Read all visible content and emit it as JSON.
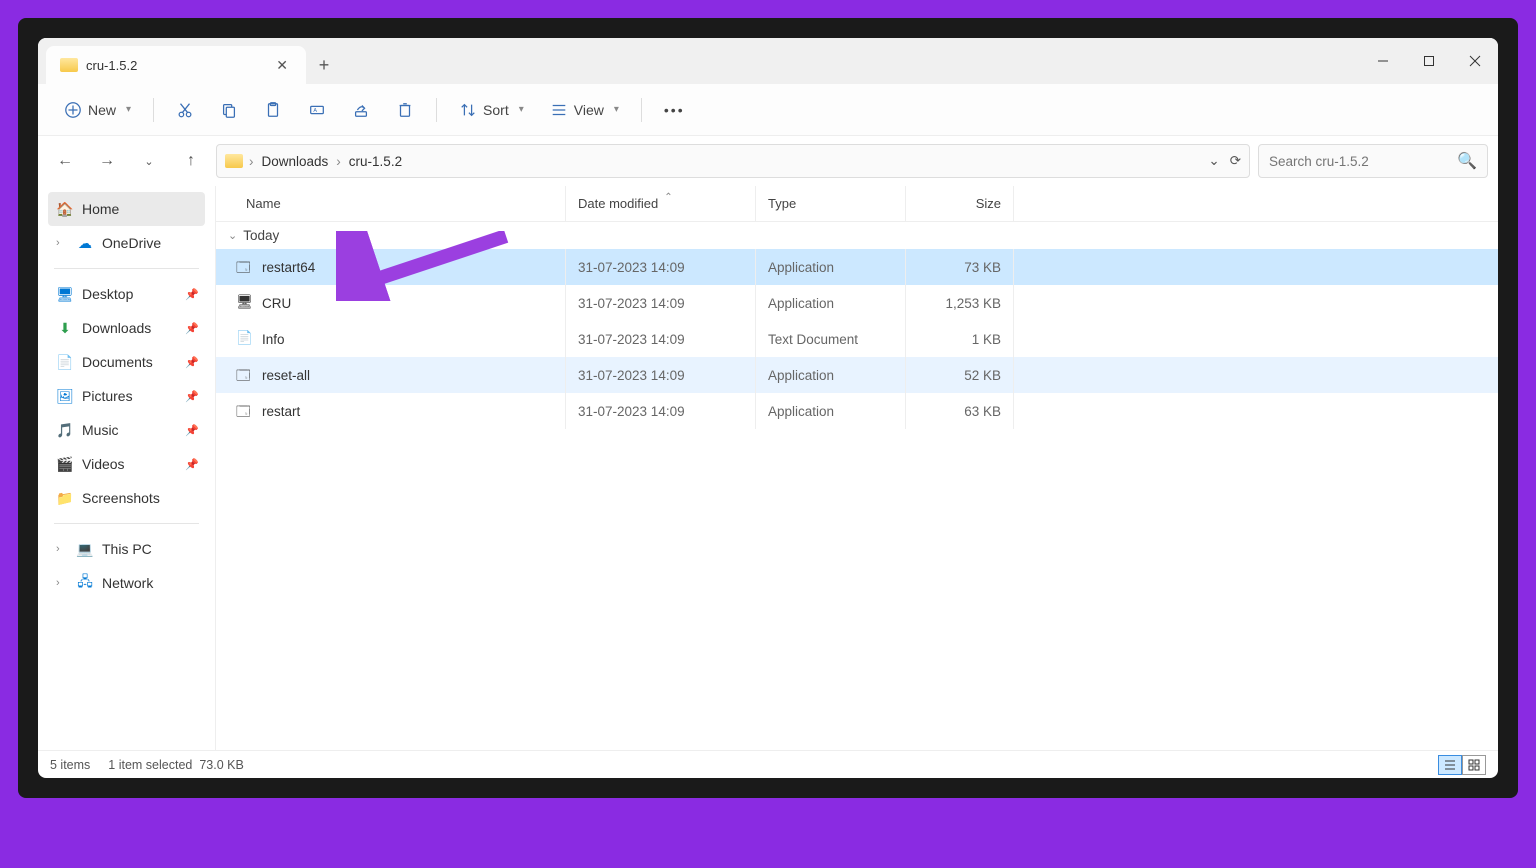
{
  "tab": {
    "title": "cru-1.5.2"
  },
  "toolbar": {
    "new": "New",
    "sort": "Sort",
    "view": "View"
  },
  "breadcrumb": {
    "items": [
      "Downloads",
      "cru-1.5.2"
    ]
  },
  "search": {
    "placeholder": "Search cru-1.5.2"
  },
  "sidebar": {
    "home": "Home",
    "onedrive": "OneDrive",
    "desktop": "Desktop",
    "downloads": "Downloads",
    "documents": "Documents",
    "pictures": "Pictures",
    "music": "Music",
    "videos": "Videos",
    "screenshots": "Screenshots",
    "thispc": "This PC",
    "network": "Network"
  },
  "columns": {
    "name": "Name",
    "date": "Date modified",
    "type": "Type",
    "size": "Size"
  },
  "group": "Today",
  "files": [
    {
      "name": "restart64",
      "date": "31-07-2023 14:09",
      "type": "Application",
      "size": "73 KB",
      "icon": "app",
      "sel": true
    },
    {
      "name": "CRU",
      "date": "31-07-2023 14:09",
      "type": "Application",
      "size": "1,253 KB",
      "icon": "cru",
      "sel": false
    },
    {
      "name": "Info",
      "date": "31-07-2023 14:09",
      "type": "Text Document",
      "size": "1 KB",
      "icon": "txt",
      "sel": false
    },
    {
      "name": "reset-all",
      "date": "31-07-2023 14:09",
      "type": "Application",
      "size": "52 KB",
      "icon": "app",
      "sel": false,
      "alt": true
    },
    {
      "name": "restart",
      "date": "31-07-2023 14:09",
      "type": "Application",
      "size": "63 KB",
      "icon": "app",
      "sel": false
    }
  ],
  "status": {
    "items": "5 items",
    "selected": "1 item selected",
    "size": "73.0 KB"
  }
}
